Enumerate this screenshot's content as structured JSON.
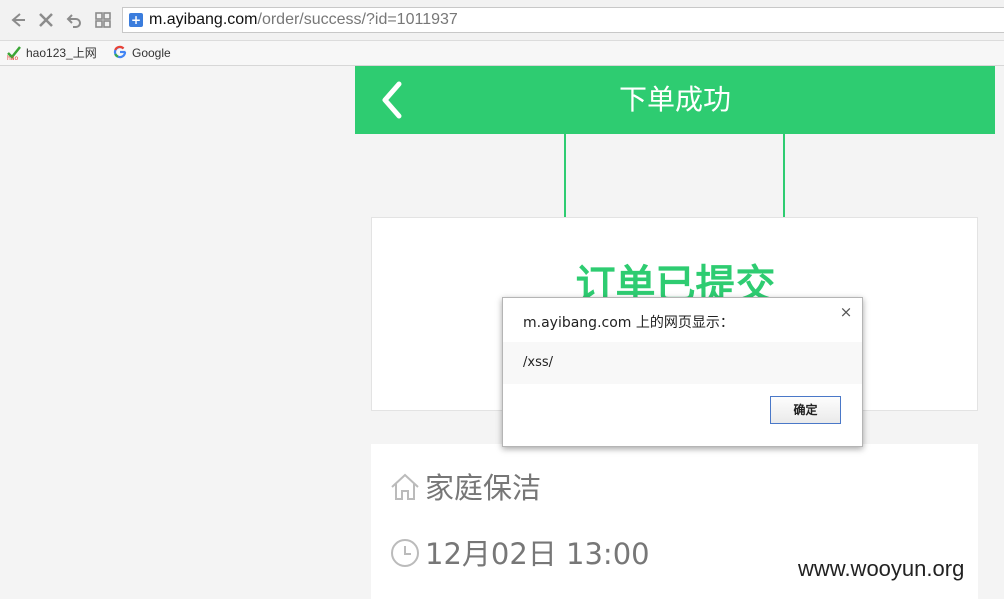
{
  "browser": {
    "url_host": "m.ayibang.com",
    "url_path": "/order/success/?id=1011937",
    "bookmarks": [
      {
        "label": "hao123_上网",
        "icon": "hao123-icon"
      },
      {
        "label": "Google",
        "icon": "google-icon"
      }
    ]
  },
  "header": {
    "title": "下单成功",
    "back_icon": "chevron-left-icon"
  },
  "card": {
    "title": "订单已提交"
  },
  "info": {
    "service": "家庭保洁",
    "service_icon": "home-icon",
    "time": "12月02日 13:00",
    "time_icon": "clock-icon"
  },
  "dialog": {
    "title": "m.ayibang.com 上的网页显示：",
    "message": "/xss/",
    "ok_label": "确定",
    "close_symbol": "×"
  },
  "watermark": "www.wooyun.org",
  "colors": {
    "accent": "#2ecc71"
  }
}
